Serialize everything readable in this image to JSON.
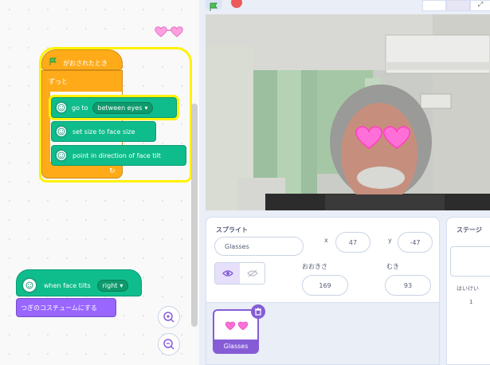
{
  "code_area": {
    "hat_label": "がおされたとき",
    "forever_label": "ずっと",
    "go_to_label": "go to",
    "go_to_dropdown": "between eyes",
    "set_size_label": "set size to face size",
    "point_label": "point in direction of face tilt",
    "face_tilts_label": "when face tilts",
    "face_tilts_dropdown": "right",
    "costume_label": "つぎのコスチュームにする"
  },
  "sprite_info": {
    "sprite_label": "スプライト",
    "sprite_name": "Glasses",
    "x_label": "x",
    "x_value": "47",
    "y_label": "y",
    "y_value": "-47",
    "size_label": "おおきさ",
    "size_value": "169",
    "direction_label": "むき",
    "direction_value": "93"
  },
  "sprite_list": {
    "items": [
      {
        "name": "Glasses"
      }
    ]
  },
  "stage_panel": {
    "title": "ステージ",
    "backdrop_label": "はいけい",
    "backdrop_count": "1"
  },
  "colors": {
    "hat_yellow": "#ffab19",
    "extension_green": "#0fbd8c",
    "looks_purple": "#9966ff",
    "highlight": "#fff200"
  },
  "icons": [
    "green-flag-icon",
    "stop-icon",
    "face-sensing-icon",
    "zoom-in-icon",
    "zoom-out-icon",
    "show-icon",
    "hide-icon",
    "delete-icon",
    "heart-glasses-icon",
    "chevron-down-icon"
  ]
}
